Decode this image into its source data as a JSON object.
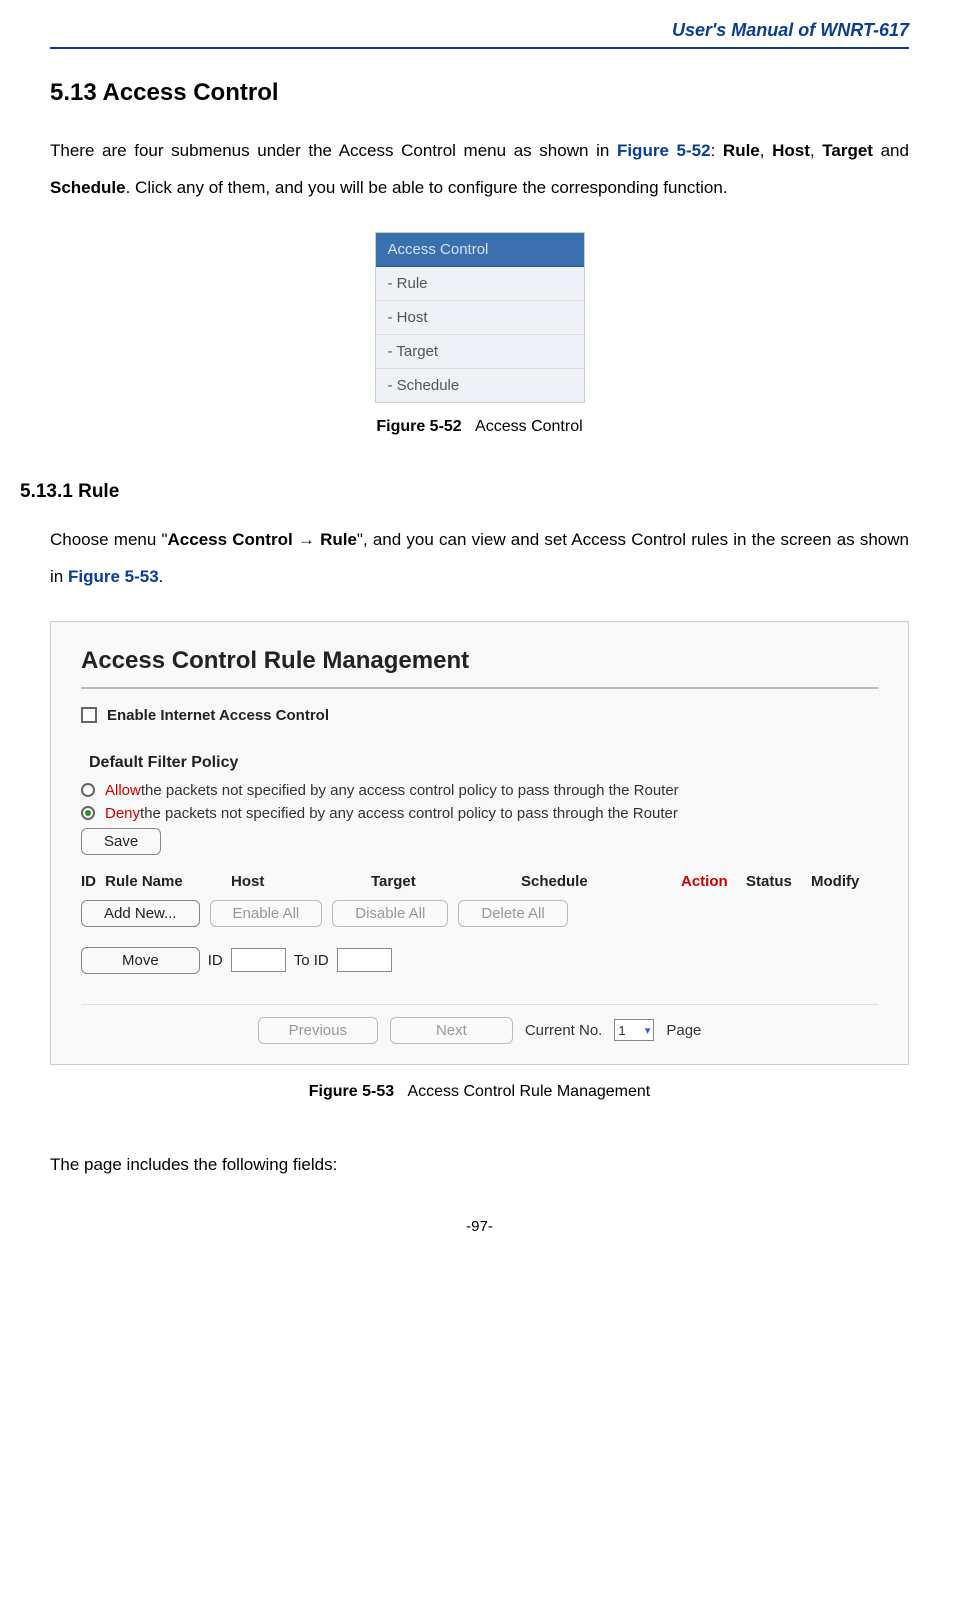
{
  "header": {
    "title": "User's  Manual  of  WNRT-617"
  },
  "section": {
    "heading": "5.13  Access Control",
    "intro_parts": {
      "t1": "There are four submenus under the Access Control menu as shown in ",
      "figref": "Figure 5-52",
      "t2": ": ",
      "b_rule": "Rule",
      "t3": ", ",
      "b_host": "Host",
      "t4": ", ",
      "b_target": "Target",
      "t5": " and ",
      "b_schedule": "Schedule",
      "t6": ". Click any of them, and you will be able to configure the corresponding function."
    }
  },
  "menu": {
    "header": "Access Control",
    "items": [
      "- Rule",
      "- Host",
      "- Target",
      "- Schedule"
    ]
  },
  "caption1": {
    "label": "Figure 5-52",
    "desc": "Access Control"
  },
  "subsection": {
    "heading": "5.13.1 Rule",
    "intro_parts": {
      "t1": "Choose menu \"",
      "b_path": "Access Control → Rule",
      "t2": "\", and you can view and set Access Control rules in the screen as shown in ",
      "figref": "Figure 5-53",
      "t3": "."
    }
  },
  "panel": {
    "title": "Access Control Rule Management",
    "enable_label": "Enable Internet Access Control",
    "policy_heading": "Default Filter Policy",
    "allow_word": "Allow",
    "deny_word": "Deny",
    "policy_suffix": " the packets not specified by any access control policy to pass through the Router",
    "save_btn": "Save",
    "cols": {
      "id": "ID",
      "rule": "Rule Name",
      "host": "Host",
      "target": "Target",
      "schedule": "Schedule",
      "action": "Action",
      "status": "Status",
      "modify": "Modify"
    },
    "add_btn": "Add New...",
    "enable_all": "Enable All",
    "disable_all": "Disable All",
    "delete_all": "Delete All",
    "move_btn": "Move",
    "id_label": "ID",
    "to_id_label": "To ID",
    "prev_btn": "Previous",
    "next_btn": "Next",
    "current_no": "Current No.",
    "page_word": "Page",
    "page_value": "1"
  },
  "caption2": {
    "label": "Figure 5-53",
    "desc": "Access Control Rule Management"
  },
  "trailing_text": "The page includes the following fields:",
  "page_number": "-97-"
}
